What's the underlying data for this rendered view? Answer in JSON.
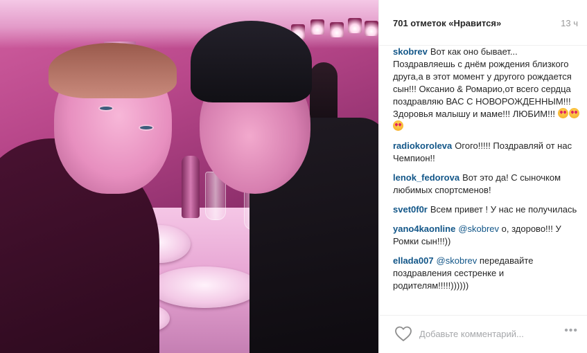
{
  "photo": {
    "icon": "selfie-photo"
  },
  "header": {
    "likes": "701 отметок «Нравится»",
    "time": "13 ч"
  },
  "caption": {
    "user": "skobrev",
    "text": "Вот как оно бывает... Поздравляешь с днём рождения близкого друга,а в этот момент у другого рождается сын!!! Оксанио & Ромарио,от всего сердца поздравляю ВАС С НОВОРОЖДЕННЫМ!!! Здоровья малышу и маме!!! ЛЮБИМ!!!",
    "emoji": "heart-eyes-emoji"
  },
  "comments": [
    {
      "user": "radiokoroleva",
      "mention": "",
      "text": "Огого!!!!! Поздравляй от нас Чемпион!!"
    },
    {
      "user": "lenok_fedorova",
      "mention": "",
      "text": "Вот это да! С сыночком любимых спортсменов!"
    },
    {
      "user": "svet0f0r",
      "mention": "",
      "text": "Всем привет ! У нас не получилась"
    },
    {
      "user": "yano4kaonline",
      "mention": "@skobrev",
      "text": "о, здорово!!! У Ромки сын!!!))"
    },
    {
      "user": "ellada007",
      "mention": "@skobrev",
      "text": "передавайте поздравления сестренке и родителям!!!!!))))))"
    }
  ],
  "footer": {
    "like_icon": "heart-outline-icon",
    "placeholder": "Добавьте комментарий...",
    "more": "•••"
  }
}
